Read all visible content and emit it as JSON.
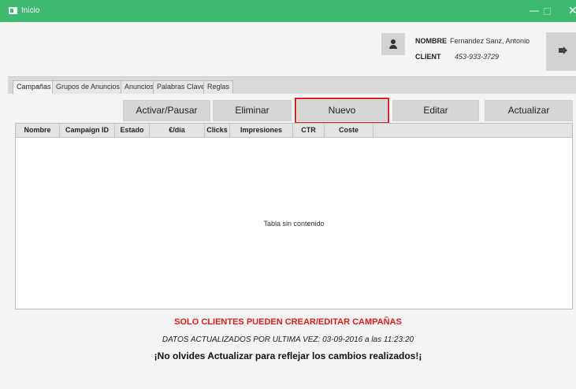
{
  "window": {
    "title": "Inicio",
    "min_glyph": "—",
    "close_glyph": "✕"
  },
  "user": {
    "name_label": "NOMBRE",
    "name_value": "Fernandez Sanz, Antonio",
    "client_label": "CLIENT",
    "client_value": "453-933-3729",
    "avatar_icon": "user-icon",
    "logout_icon": "logout-icon"
  },
  "tabs": [
    "Campañas",
    "Grupos de Anuncios",
    "Anuncios",
    "Palabras Clave",
    "Reglas"
  ],
  "toolbar": {
    "toggle_label": "Activar/Pausar",
    "delete_label": "Eliminar",
    "new_label": "Nuevo",
    "edit_label": "Editar",
    "refresh_label": "Actualizar"
  },
  "table": {
    "columns": [
      "Nombre",
      "Campaign ID",
      "Estado",
      "€/día",
      "Clicks",
      "Impresiones",
      "CTR",
      "Coste"
    ],
    "empty_text": "Tabla sin contenido"
  },
  "footer": {
    "warning": "SOLO CLIENTES PUEDEN CREAR/EDITAR CAMPAÑAS",
    "updated": "DATOS ACTUALIZADOS POR ULTIMA VEZ: 03-09-2016 a las 11:23:20",
    "reminder": "¡No olvides Actualizar para reflejar los cambios realizados!¡"
  },
  "colors": {
    "titlebar": "#3dba70",
    "warning": "#e01b1b",
    "highlight": "#e02020"
  }
}
